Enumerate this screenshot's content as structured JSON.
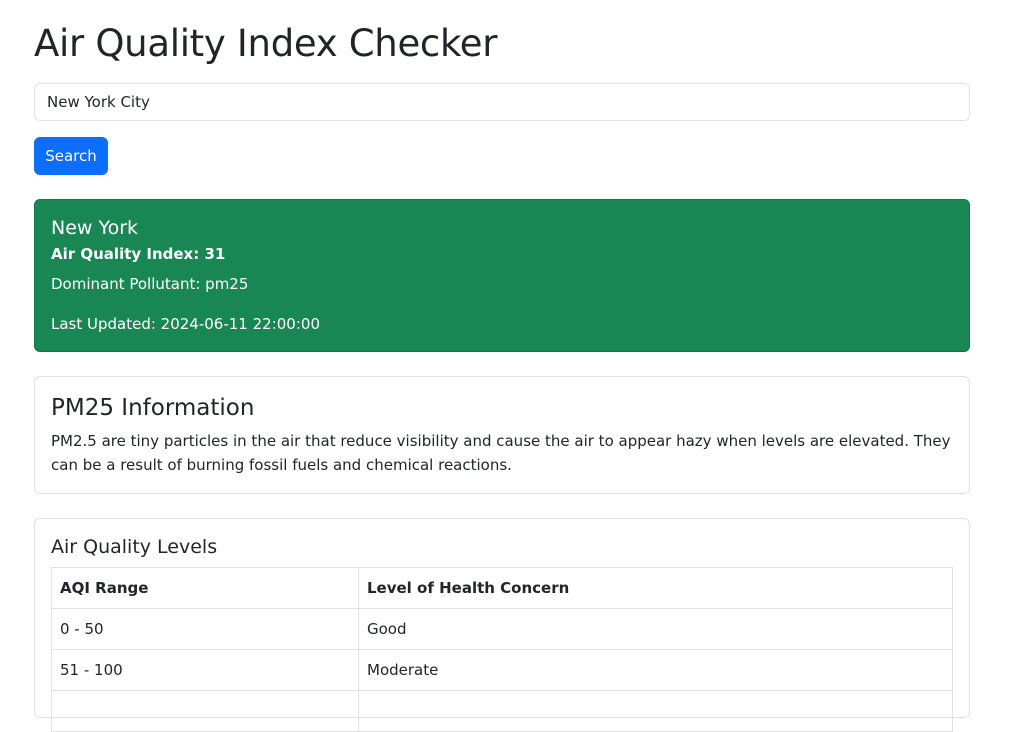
{
  "page": {
    "title": "Air Quality Index Checker"
  },
  "search": {
    "value": "New York City",
    "button_label": "Search"
  },
  "result": {
    "city": "New York",
    "aqi_text": "Air Quality Index: 31",
    "pollutant_text": "Dominant Pollutant: pm25",
    "updated_text": "Last Updated: 2024-06-11 22:00:00",
    "background_color": "#198754"
  },
  "pollutant_info": {
    "title": "PM25 Information",
    "description": "PM2.5 are tiny particles in the air that reduce visibility and cause the air to appear hazy when levels are elevated. They can be a result of burning fossil fuels and chemical reactions."
  },
  "levels": {
    "title": "Air Quality Levels",
    "headers": [
      "AQI Range",
      "Level of Health Concern"
    ],
    "rows": [
      [
        "0 - 50",
        "Good"
      ],
      [
        "51 - 100",
        "Moderate"
      ],
      [
        "",
        ""
      ]
    ]
  },
  "colors": {
    "primary": "#0d6efd",
    "success": "#198754",
    "border": "#dee2e6",
    "text": "#212529"
  }
}
